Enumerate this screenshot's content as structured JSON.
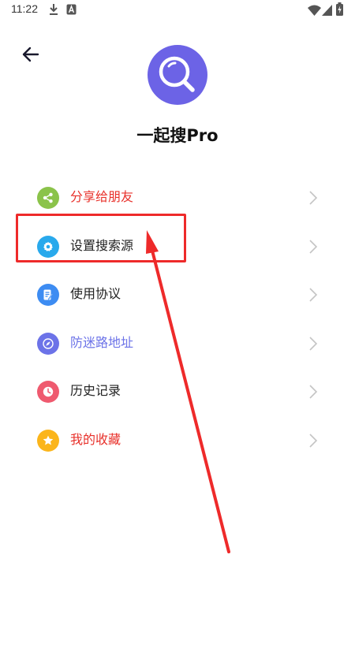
{
  "status_bar": {
    "time": "11:22",
    "icons": [
      "download-icon",
      "notification-a-icon",
      "wifi-icon",
      "signal-icon",
      "battery-charging-icon"
    ]
  },
  "header": {
    "back_icon": "arrow-left-icon",
    "logo_icon": "search-icon",
    "title": "一起搜Pro"
  },
  "menu": {
    "items": [
      {
        "label": "分享给朋友",
        "label_color": "#e8302a",
        "icon": "share-icon",
        "icon_color": "#8bc34a"
      },
      {
        "label": "设置搜索源",
        "label_color": "#222222",
        "icon": "gear-icon",
        "icon_color": "#29a9ec"
      },
      {
        "label": "使用协议",
        "label_color": "#222222",
        "icon": "document-edit-icon",
        "icon_color": "#3d8cf2"
      },
      {
        "label": "防迷路地址",
        "label_color": "#6c73e8",
        "icon": "compass-icon",
        "icon_color": "#6c73e8"
      },
      {
        "label": "历史记录",
        "label_color": "#222222",
        "icon": "clock-icon",
        "icon_color": "#ef5a6f"
      },
      {
        "label": "我的收藏",
        "label_color": "#e8302a",
        "icon": "star-icon",
        "icon_color": "#fbb51b"
      }
    ],
    "chevron_icon": "chevron-right-icon"
  },
  "annotation": {
    "color": "#ee2a2a",
    "highlighted_item": "设置搜索源"
  }
}
